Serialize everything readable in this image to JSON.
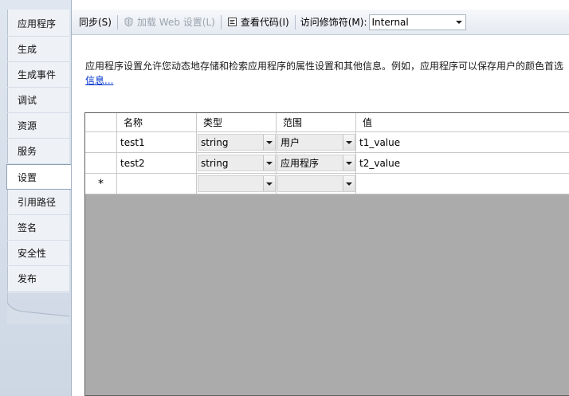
{
  "sidebar": {
    "items": [
      {
        "label": "应用程序"
      },
      {
        "label": "生成"
      },
      {
        "label": "生成事件"
      },
      {
        "label": "调试"
      },
      {
        "label": "资源"
      },
      {
        "label": "服务"
      },
      {
        "label": "设置",
        "active": true
      },
      {
        "label": "引用路径"
      },
      {
        "label": "签名"
      },
      {
        "label": "安全性"
      },
      {
        "label": "发布"
      }
    ]
  },
  "toolbar": {
    "sync_label": "同步(S)",
    "load_web_label": "加载 Web 设置(L)",
    "view_code_label": "查看代码(I)",
    "access_modifier_label": "访问修饰符(M):",
    "access_modifier_value": "Internal"
  },
  "description": {
    "text": "应用程序设置允许您动态地存储和检索应用程序的属性设置和其他信息。例如，应用程序可以保存用户的颜色首选",
    "link": "信息..."
  },
  "grid": {
    "columns": [
      "名称",
      "类型",
      "范围",
      "值"
    ],
    "rows": [
      {
        "name": "test1",
        "type": "string",
        "scope": "用户",
        "value": "t1_value"
      },
      {
        "name": "test2",
        "type": "string",
        "scope": "应用程序",
        "value": "t2_value"
      }
    ],
    "new_row_marker": "*"
  },
  "colors": {
    "sidebar_bg": "#dfe6ef",
    "toolbar_bg": "#e5eaf1",
    "link": "#0033cc",
    "grid_empty": "#ababab"
  }
}
